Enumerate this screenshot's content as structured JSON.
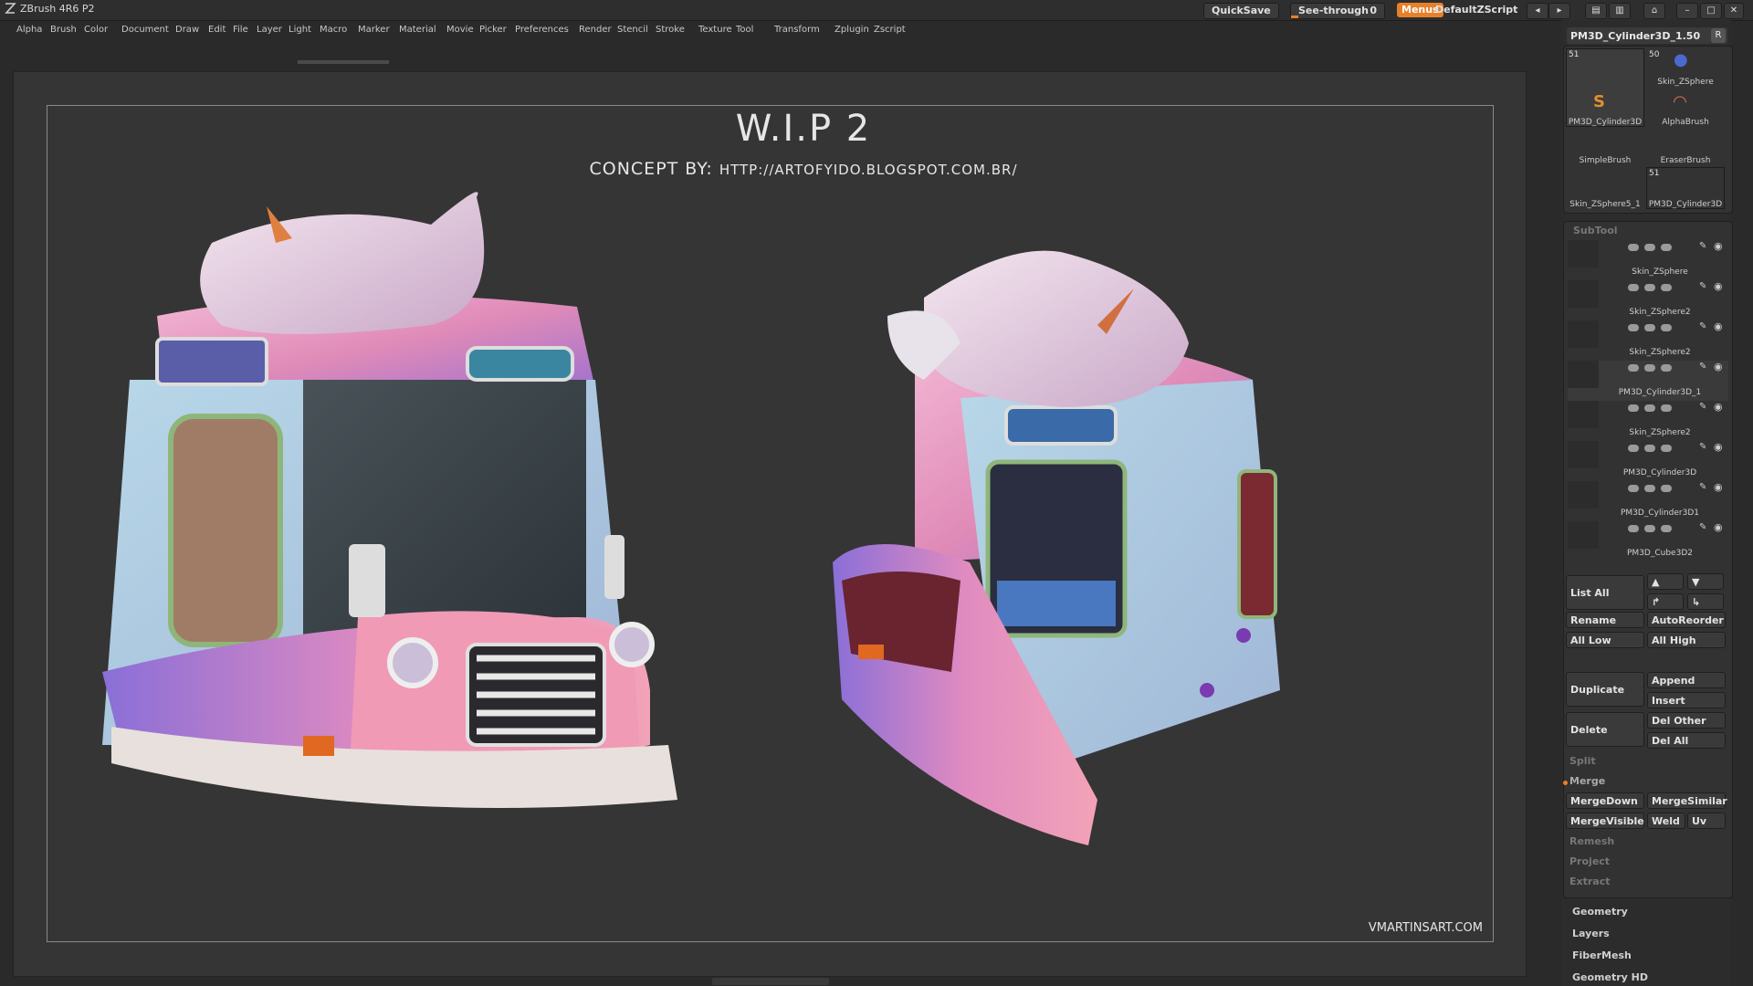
{
  "app": {
    "title": "ZBrush 4R6 P2"
  },
  "topbar": {
    "quicksave": "QuickSave",
    "see_through_label": "See-through",
    "see_through_value": "0",
    "see_through_fraction": 0.0,
    "menus": "Menus",
    "script": "DefaultZScript"
  },
  "menubar": [
    "Alpha",
    "Brush",
    "Color",
    "Document",
    "Draw",
    "Edit",
    "File",
    "Layer",
    "Light",
    "Macro",
    "Marker",
    "Material",
    "Movie",
    "Picker",
    "Preferences",
    "Render",
    "Stencil",
    "Stroke",
    "Texture",
    "Tool",
    "Transform",
    "Zplugin",
    "Zscript"
  ],
  "canvas": {
    "title": "W.I.P 2",
    "concept_prefix": "CONCEPT BY:",
    "concept_url": "HTTP://ARTOFYIDO.BLOGSPOT.COM.BR/",
    "credit": "VMARTINSART.COM"
  },
  "tool": {
    "current_name": "PM3D_Cylinder3D_1.50",
    "r_button": "R",
    "thumbs": [
      {
        "num": "51",
        "label": "PM3D_Cylinder3D"
      },
      {
        "num": "50",
        "label": "Skin_ZSphere"
      },
      {
        "num": "",
        "label": "AlphaBrush"
      },
      {
        "num": "",
        "label": "SimpleBrush"
      },
      {
        "num": "",
        "label": "EraserBrush"
      },
      {
        "num": "",
        "label": "Skin_ZSphere5_1"
      },
      {
        "num": "51",
        "label": "PM3D_Cylinder3D"
      }
    ]
  },
  "subtool": {
    "title": "SubTool",
    "items": [
      "Skin_ZSphere",
      "Skin_ZSphere2",
      "Skin_ZSphere2",
      "PM3D_Cylinder3D_1",
      "Skin_ZSphere2",
      "PM3D_Cylinder3D",
      "PM3D_Cylinder3D1",
      "PM3D_Cube3D2"
    ],
    "list_all": "List All",
    "rename": "Rename",
    "autoreorder": "AutoReorder",
    "all_low": "All Low",
    "all_high": "All High",
    "duplicate": "Duplicate",
    "append": "Append",
    "insert": "Insert",
    "delete": "Delete",
    "del_other": "Del Other",
    "del_all": "Del All",
    "split": "Split",
    "merge": "Merge",
    "mergedown": "MergeDown",
    "mergesimilar": "MergeSimilar",
    "mergevisible": "MergeVisible",
    "weld": "Weld",
    "uv": "Uv",
    "remesh": "Remesh",
    "project": "Project",
    "extract": "Extract"
  },
  "sections": [
    "Geometry",
    "Layers",
    "FiberMesh",
    "Geometry HD"
  ],
  "colors": {
    "accent": "#e8802a",
    "panel": "#2c2c2c",
    "canvas": "#353535"
  }
}
